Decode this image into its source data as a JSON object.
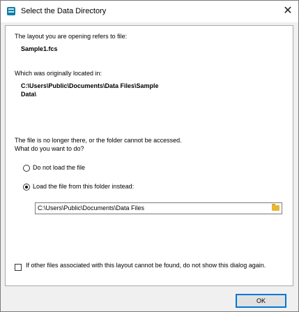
{
  "window": {
    "title": "Select the Data Directory",
    "close_glyph": "✕"
  },
  "content": {
    "intro": "The layout you are opening refers to file:",
    "filename": "Sample1.fcs",
    "original_location_label": "Which was originally located in:",
    "original_path_line1": "C:\\Users\\Public\\Documents\\Data Files\\Sample",
    "original_path_line2": "Data\\",
    "problem_line1": "The file is no longer there, or the folder cannot be accessed.",
    "problem_line2": "What do you want to do?"
  },
  "options": {
    "do_not_load": {
      "label": "Do not load the file",
      "selected": false
    },
    "load_from_folder": {
      "label": "Load the file from this folder instead:",
      "selected": true
    }
  },
  "folder_field": {
    "value": "C:\\Users\\Public\\Documents\\Data Files",
    "icon": "folder-icon"
  },
  "dont_show_checkbox": {
    "label": "If other files associated with this layout cannot be found, do not show this dialog again.",
    "checked": false
  },
  "buttons": {
    "ok_label": "OK"
  },
  "colors": {
    "accent": "#0078d7",
    "folder": "#e8b830",
    "app_icon": "#0e7fa6"
  }
}
